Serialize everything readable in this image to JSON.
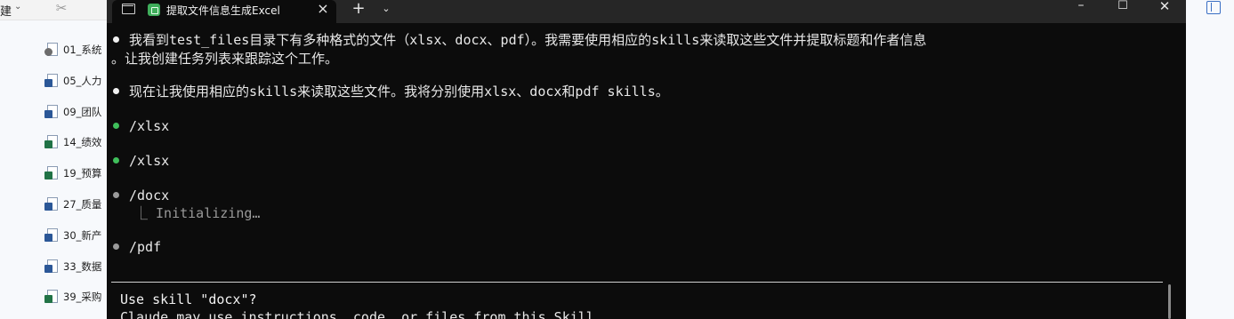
{
  "explorer": {
    "toolbar_new": "建",
    "files": [
      {
        "name": "01_系统",
        "icon": "gear-file-icon"
      },
      {
        "name": "05_人力",
        "icon": "word-file-icon"
      },
      {
        "name": "09_团队",
        "icon": "word-file-icon"
      },
      {
        "name": "14_绩效",
        "icon": "excel-file-icon"
      },
      {
        "name": "19_预算",
        "icon": "excel-file-icon"
      },
      {
        "name": "27_质量",
        "icon": "word-file-icon"
      },
      {
        "name": "30_新产",
        "icon": "word-file-icon"
      },
      {
        "name": "33_数据",
        "icon": "word-file-icon"
      },
      {
        "name": "39_采购",
        "icon": "excel-file-icon"
      }
    ]
  },
  "terminal": {
    "tab_title": "提取文件信息生成Excel",
    "lines": [
      {
        "bullet": "white",
        "text": "我看到test_files目录下有多种格式的文件（xlsx、docx、pdf）。我需要使用相应的skills来读取这些文件并提取标题和作者信息"
      },
      {
        "bullet": "",
        "text": "。让我创建任务列表来跟踪这个工作。"
      },
      {
        "bullet": "white",
        "text": "现在让我使用相应的skills来读取这些文件。我将分别使用xlsx、docx和pdf skills。"
      },
      {
        "bullet": "green",
        "text": "/xlsx"
      },
      {
        "bullet": "green",
        "text": "/xlsx"
      },
      {
        "bullet": "gray",
        "text": "/docx"
      },
      {
        "bullet": "gray",
        "text": "/pdf"
      }
    ],
    "sub_status": "⎿ Initializing…",
    "prompt": {
      "title": "Use skill \"docx\"?",
      "body": "Claude may use instructions, code, or files from this Skill."
    }
  },
  "colors": {
    "terminal_bg": "#0c0c0c",
    "titlebar_bg": "#262626",
    "bullet_green": "#3fbf5b",
    "bullet_gray": "#9a9a9a"
  }
}
